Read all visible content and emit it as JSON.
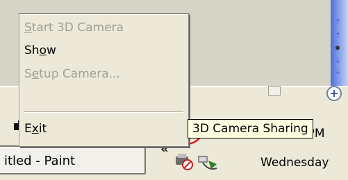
{
  "context_menu": {
    "items": [
      {
        "pre": "",
        "accel": "S",
        "post": "tart 3D Camera",
        "enabled": false
      },
      {
        "pre": "Sh",
        "accel": "o",
        "post": "w",
        "enabled": true
      },
      {
        "pre": "S",
        "accel": "e",
        "post": "tup Camera...",
        "enabled": false
      },
      {
        "pre": "E",
        "accel": "x",
        "post": "it",
        "enabled": true
      }
    ]
  },
  "tooltip": {
    "text": "3D Camera Sharing"
  },
  "taskbar": {
    "paint_label": "itled - Paint"
  },
  "clock": {
    "time": "1:48 PM",
    "day": "Wednesday"
  },
  "glyphs": {
    "chevron_right": "»",
    "chevron_left": "«",
    "plus": "+"
  },
  "icons": [
    "camera-tray-icon",
    "network-tray-icon",
    "speaker-tray-icon",
    "printer-tray-icon",
    "safely-remove-icon",
    "camera-launch-icon",
    "webcam-launch-icon"
  ],
  "colors": {
    "highlight_ring": "#e0141b",
    "tooltip_bg": "#ffffe1",
    "xp_blue": "#3a67d8"
  }
}
